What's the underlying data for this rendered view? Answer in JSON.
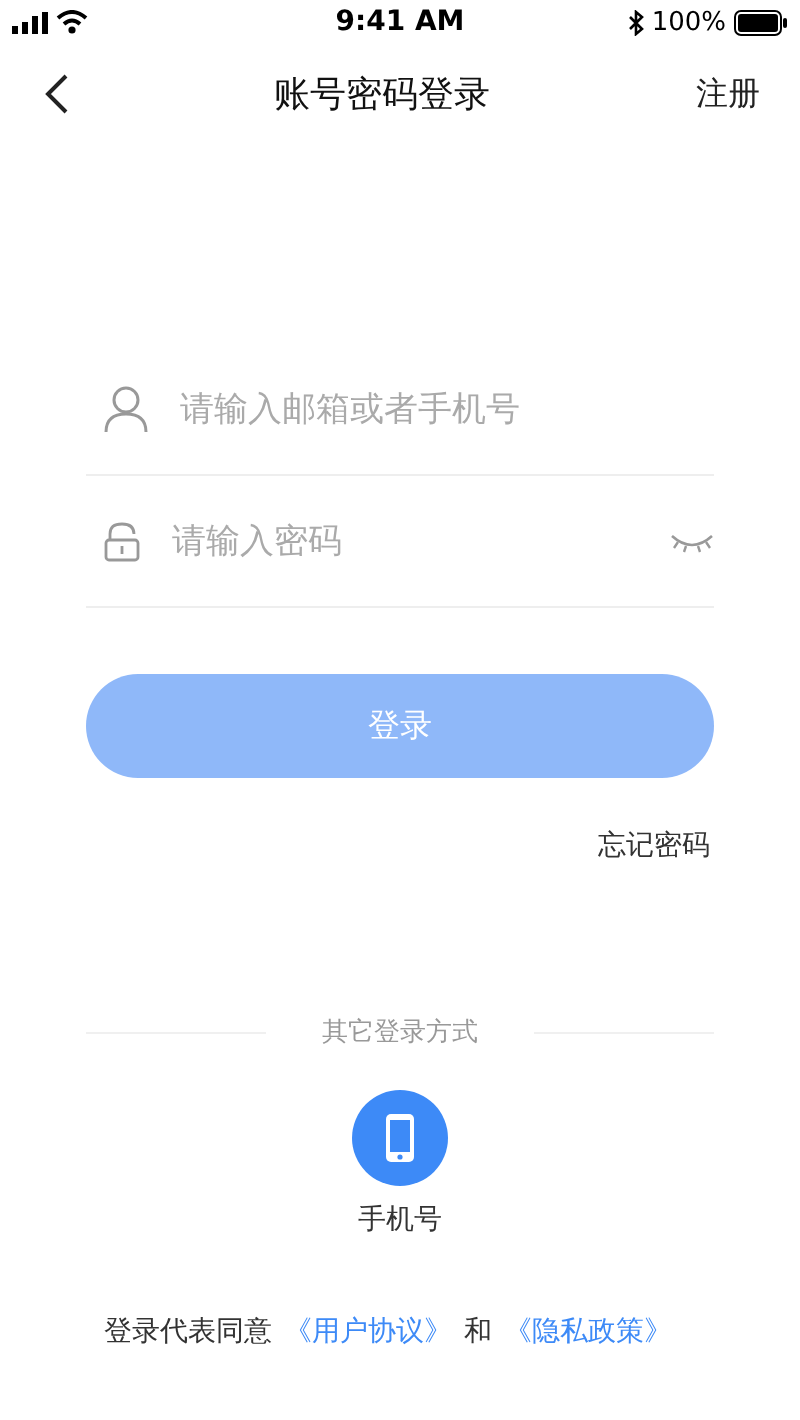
{
  "status_bar": {
    "time": "9:41 AM",
    "battery": "100%"
  },
  "nav": {
    "title": "账号密码登录",
    "action": "注册"
  },
  "fields": [
    {
      "kind": "account",
      "placeholder": "请输入邮箱或者手机号"
    },
    {
      "kind": "password",
      "placeholder": "请输入密码",
      "reveal": false
    }
  ],
  "login_button": {
    "label": "登录",
    "disabled": true
  },
  "forgot": "忘记密码",
  "other_login": {
    "heading": "其它登录方式",
    "methods": [
      {
        "kind": "phone",
        "label": "手机号"
      }
    ]
  },
  "agreement": {
    "text": "登录代表同意",
    "links": [
      "《用户协议》",
      "《隐私政策》"
    ],
    "joiner": "和"
  }
}
